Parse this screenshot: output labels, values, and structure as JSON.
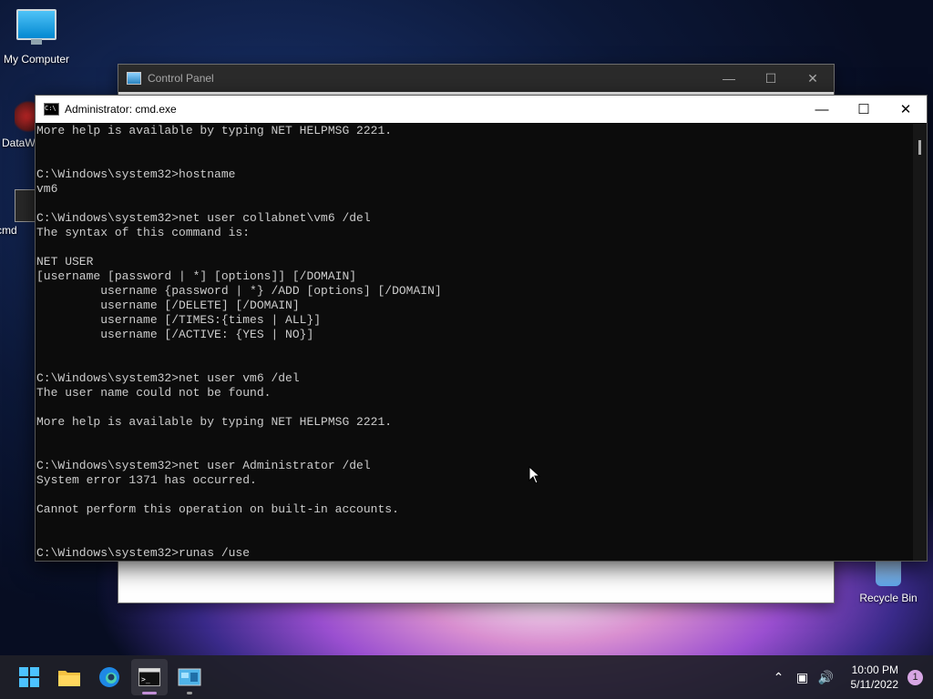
{
  "desktop": {
    "icons": [
      {
        "label": "My Computer"
      },
      {
        "label": "DataW"
      },
      {
        "label": "cmd"
      },
      {
        "label": "Recycle Bin"
      }
    ]
  },
  "control_panel": {
    "title": "Control Panel"
  },
  "cmd_window": {
    "title": "Administrator: cmd.exe",
    "lines": [
      "More help is available by typing NET HELPMSG 2221.",
      "",
      "",
      "C:\\Windows\\system32>hostname",
      "vm6",
      "",
      "C:\\Windows\\system32>net user collabnet\\vm6 /del",
      "The syntax of this command is:",
      "",
      "NET USER",
      "[username [password | *] [options]] [/DOMAIN]",
      "         username {password | *} /ADD [options] [/DOMAIN]",
      "         username [/DELETE] [/DOMAIN]",
      "         username [/TIMES:{times | ALL}]",
      "         username [/ACTIVE: {YES | NO}]",
      "",
      "",
      "C:\\Windows\\system32>net user vm6 /del",
      "The user name could not be found.",
      "",
      "More help is available by typing NET HELPMSG 2221.",
      "",
      "",
      "C:\\Windows\\system32>net user Administrator /del",
      "System error 1371 has occurred.",
      "",
      "Cannot perform this operation on built-in accounts.",
      "",
      "",
      "C:\\Windows\\system32>runas /use"
    ]
  },
  "taskbar": {
    "apps": [
      {
        "name": "start-button-icon"
      },
      {
        "name": "file-explorer-icon"
      },
      {
        "name": "edge-browser-icon"
      },
      {
        "name": "terminal-icon"
      },
      {
        "name": "control-panel-icon"
      }
    ],
    "clock": {
      "time": "10:00 PM",
      "date": "5/11/2022"
    },
    "notification_count": "1"
  }
}
